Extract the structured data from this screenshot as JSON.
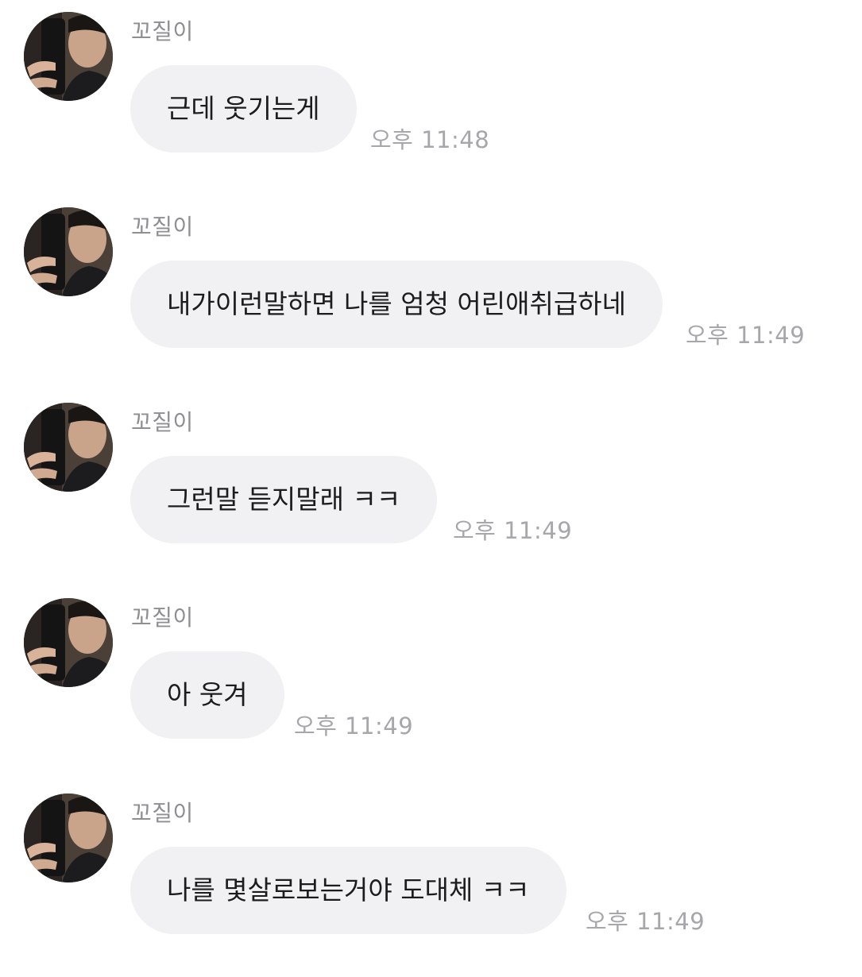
{
  "messages": [
    {
      "sender": "꼬질이",
      "text": "근데 웃기는게",
      "time": "오후 11:48",
      "avatar_icon": "profile-photo"
    },
    {
      "sender": "꼬질이",
      "text": "내가이런말하면 나를 엄청 어린애취급하네",
      "time": "오후 11:49",
      "avatar_icon": "profile-photo"
    },
    {
      "sender": "꼬질이",
      "text": "그런말 듣지말래 ㅋㅋ",
      "time": "오후 11:49",
      "avatar_icon": "profile-photo"
    },
    {
      "sender": "꼬질이",
      "text": "아 웃겨",
      "time": "오후 11:49",
      "avatar_icon": "profile-photo"
    },
    {
      "sender": "꼬질이",
      "text": "나를 몇살로보는거야 도대체 ㅋㅋ",
      "time": "오후 11:49",
      "avatar_icon": "profile-photo"
    }
  ],
  "colors": {
    "bubble_bg": "#f1f1f3",
    "sender_text": "#8e8e93",
    "time_text": "#a7a7ab",
    "message_text": "#1c1c1e"
  }
}
